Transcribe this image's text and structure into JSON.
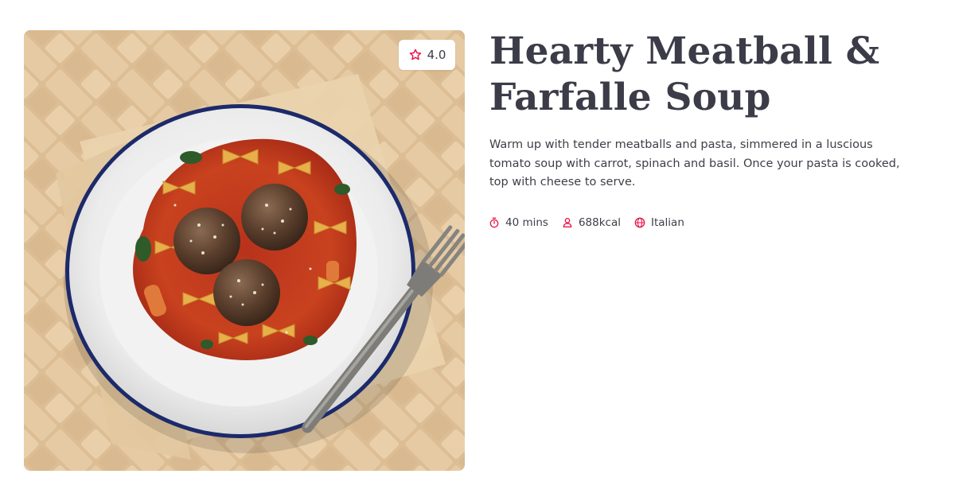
{
  "recipe": {
    "title": "Hearty Meatball & Farfalle Soup",
    "description": "Warm up with tender meatballs and pasta, simmered in a luscious tomato soup with carrot, spinach and basil. Once your pasta is cooked, top with cheese to serve.",
    "rating": "4.0",
    "image_alt": "Bowl of meatball and farfalle tomato soup with a fork",
    "meta": {
      "time": "40 mins",
      "calories": "688kcal",
      "cuisine": "Italian"
    }
  },
  "icons": {
    "rating": "star-icon",
    "time": "stopwatch-icon",
    "calories": "person-icon",
    "cuisine": "globe-icon"
  },
  "colors": {
    "accent": "#e8174a",
    "title": "#3c3c48",
    "text": "#3e3e48",
    "background": "#ffffff"
  }
}
